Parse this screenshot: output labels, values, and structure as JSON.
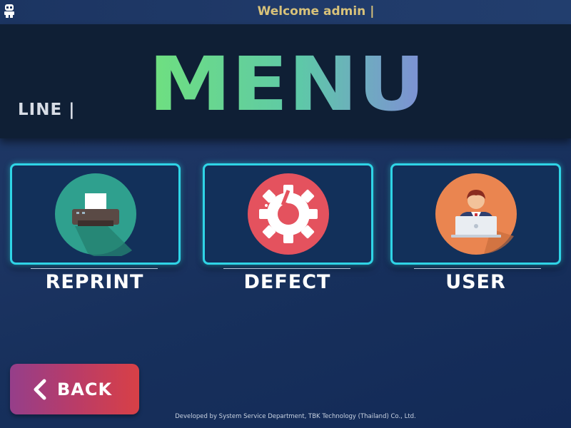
{
  "header": {
    "welcome_text": "Welcome admin |",
    "line_label": "LINE |",
    "title": "MENU"
  },
  "menu": {
    "items": [
      {
        "label": "REPRINT",
        "icon": "printer-icon",
        "icon_bg": "#2fa08e"
      },
      {
        "label": "DEFECT",
        "icon": "broken-gear-icon",
        "icon_bg": "#e4525e"
      },
      {
        "label": "USER",
        "icon": "user-laptop-icon",
        "icon_bg": "#ea8550"
      }
    ]
  },
  "back_button": {
    "label": "BACK"
  },
  "footer": {
    "text": "Developed by System Service Department, TBK Technology (Thailand) Co., Ltd."
  },
  "colors": {
    "card_border": "#2fd4e6",
    "welcome_text": "#d8c27a",
    "title_gradient_start": "#6fe07f",
    "title_gradient_end": "#7f8fd6"
  }
}
